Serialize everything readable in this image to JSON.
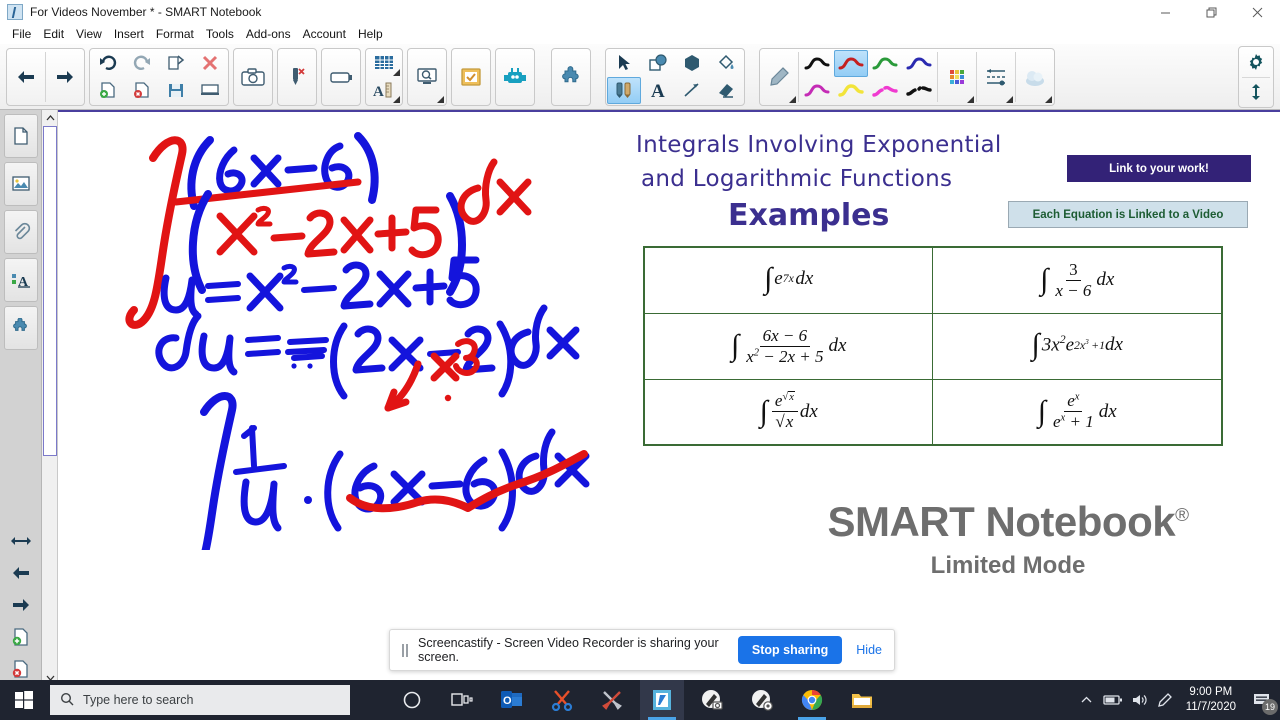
{
  "window": {
    "title": "For Videos November * - SMART Notebook",
    "app_icon": "smart-notebook-icon",
    "controls": {
      "minimize": "minimize-icon",
      "restore": "restore-icon",
      "close": "close-icon"
    }
  },
  "menu": {
    "items": [
      {
        "label": "File"
      },
      {
        "label": "Edit"
      },
      {
        "label": "View"
      },
      {
        "label": "Insert"
      },
      {
        "label": "Format"
      },
      {
        "label": "Tools"
      },
      {
        "label": "Add-ons"
      },
      {
        "label": "Account"
      },
      {
        "label": "Help"
      }
    ]
  },
  "toolbar": {
    "groups": [
      {
        "name": "navigation",
        "buttons": [
          "previous-page-icon",
          "next-page-icon"
        ]
      },
      {
        "name": "file-edit",
        "buttons": [
          "undo-icon",
          "redo-icon",
          "open-icon",
          "delete-icon",
          "add-page-icon",
          "delete-page-icon",
          "save-icon",
          "full-screen-icon"
        ]
      },
      {
        "name": "capture",
        "buttons": [
          "screen-capture-icon"
        ]
      },
      {
        "name": "pen-clear",
        "buttons": [
          "clear-ink-icon"
        ]
      },
      {
        "name": "shade",
        "buttons": [
          "screen-shade-icon"
        ]
      },
      {
        "name": "tables-measure",
        "buttons": [
          "table-icon",
          "measurement-tools-icon"
        ]
      },
      {
        "name": "magnify",
        "buttons": [
          "magnifier-icon"
        ]
      },
      {
        "name": "response",
        "buttons": [
          "smart-response-icon"
        ]
      },
      {
        "name": "lab",
        "buttons": [
          "lab-activity-icon"
        ]
      },
      {
        "name": "add-ons",
        "buttons": [
          "add-ons-icon"
        ]
      },
      {
        "name": "object-tools",
        "buttons": [
          "select-icon",
          "shapes-icon",
          "regular-polygons-icon",
          "fill-icon",
          "pens-icon",
          "text-icon",
          "lines-icon",
          "eraser-icon"
        ]
      },
      {
        "name": "pen-styles",
        "buttons": [
          "pen-type-icon",
          "black-pen-icon",
          "red-pen-icon",
          "green-pen-icon",
          "blue-pen-icon",
          "magenta-pen-icon",
          "yellow-highlighter-icon",
          "pink-creative-pen-icon",
          "dashed-pen-icon"
        ]
      },
      {
        "name": "properties",
        "buttons": [
          "color-palette-icon",
          "line-properties-icon",
          "transparency-icon"
        ]
      }
    ],
    "selected_tool": "pens-icon",
    "selected_pen": "red-pen-icon",
    "right_stack": [
      "settings-gear-icon",
      "move-toolbar-icon"
    ]
  },
  "sidebar": {
    "tabs": [
      {
        "name": "page-sorter",
        "icon": "page-icon"
      },
      {
        "name": "gallery",
        "icon": "gallery-icon"
      },
      {
        "name": "attachments",
        "icon": "paperclip-icon"
      },
      {
        "name": "properties",
        "icon": "properties-icon"
      },
      {
        "name": "add-ons",
        "icon": "puzzle-icon"
      }
    ],
    "bottom_tools": [
      {
        "name": "auto-hide",
        "icon": "arrows-horizontal-icon"
      },
      {
        "name": "previous-page",
        "icon": "arrow-left-icon"
      },
      {
        "name": "next-page",
        "icon": "arrow-right-icon"
      },
      {
        "name": "add-page",
        "icon": "add-page-icon"
      },
      {
        "name": "delete-page",
        "icon": "delete-page-icon"
      }
    ]
  },
  "slide": {
    "title_line1": "Integrals Involving Exponential",
    "title_line2": "and Logarithmic Functions",
    "subtitle": "Examples",
    "link_button": "Link to your work!",
    "video_note_button": "Each Equation is Linked to a Video",
    "brand_name": "SMART Notebook",
    "brand_registered": "®",
    "brand_mode": "Limited Mode",
    "equations": [
      {
        "row": 1,
        "col": 1,
        "latex": "\\int e^{7x}\\,dx"
      },
      {
        "row": 1,
        "col": 2,
        "latex": "\\int \\frac{3}{x-6}\\,dx"
      },
      {
        "row": 2,
        "col": 1,
        "latex": "\\int \\frac{6x-6}{x^2-2x+5}\\,dx"
      },
      {
        "row": 2,
        "col": 2,
        "latex": "\\int 3x^2 e^{2x^3+1}\\,dx"
      },
      {
        "row": 3,
        "col": 1,
        "latex": "\\int \\frac{e^{\\sqrt{x}}}{\\sqrt{x}}\\,dx"
      },
      {
        "row": 3,
        "col": 2,
        "latex": "\\int \\frac{e^x}{e^x+1}\\,dx"
      }
    ],
    "table_border_color": "#3a6b35",
    "handwriting": [
      {
        "name": "integral-expression",
        "text": "∫ (6x - 6)/(x² - 2x + 5) dx",
        "ink_colors": [
          "#e11414",
          "#1414dc"
        ]
      },
      {
        "name": "u-substitution",
        "text": "u = x² - 2x + 5",
        "ink_colors": [
          "#1414dc"
        ]
      },
      {
        "name": "du-line",
        "text": "du = (2x - 2) dx",
        "ink_colors": [
          "#1414dc"
        ]
      },
      {
        "name": "x3-annotation",
        "text": "x3",
        "ink_colors": [
          "#e11414"
        ]
      },
      {
        "name": "rewritten-integral",
        "text": "∫ 1/u · (6x - 6) dx",
        "ink_colors": [
          "#1414dc",
          "#e11414"
        ]
      }
    ]
  },
  "sharing_bar": {
    "message": "Screencastify - Screen Video Recorder is sharing your screen.",
    "stop_label": "Stop sharing",
    "hide_label": "Hide",
    "accent_color": "#1a73e8"
  },
  "taskbar": {
    "start_icon": "windows-start-icon",
    "search_placeholder": "Type here to search",
    "apps": [
      {
        "name": "cortana",
        "icon": "cortana-circle-icon"
      },
      {
        "name": "task-view",
        "icon": "task-view-icon"
      },
      {
        "name": "outlook",
        "icon": "outlook-icon"
      },
      {
        "name": "snipping-tool",
        "icon": "scissors-icon"
      },
      {
        "name": "tools",
        "icon": "wrench-screwdriver-icon"
      },
      {
        "name": "smart-notebook",
        "icon": "smart-notebook-icon"
      },
      {
        "name": "ink-capture",
        "icon": "pen-camera-icon"
      },
      {
        "name": "ink-settings",
        "icon": "pen-gear-icon"
      },
      {
        "name": "chrome",
        "icon": "chrome-icon"
      },
      {
        "name": "file-explorer",
        "icon": "folder-icon"
      }
    ],
    "tray": [
      {
        "name": "show-hidden",
        "icon": "chevron-up-icon"
      },
      {
        "name": "battery",
        "icon": "battery-icon"
      },
      {
        "name": "volume",
        "icon": "speaker-icon"
      },
      {
        "name": "pen-menu",
        "icon": "pen-icon"
      }
    ],
    "clock_time": "9:00 PM",
    "clock_date": "11/7/2020",
    "notification_count": "19"
  }
}
